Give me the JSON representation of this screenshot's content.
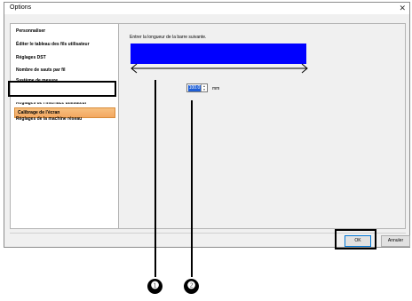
{
  "window": {
    "title": "Options",
    "close_glyph": "✕"
  },
  "sidebar": {
    "items": [
      {
        "label": "Personnaliser"
      },
      {
        "label": "Éditer le tableau des fils utilisateur"
      },
      {
        "label": "Réglages DST"
      },
      {
        "label": "Nombre de sauts par fil"
      },
      {
        "label": "Système de mesure"
      },
      {
        "label": "Calibrage de l'écran",
        "selected": true
      },
      {
        "label": "Réglages de l'interface utilisateur"
      },
      {
        "label": "Réglages de la machine réseau"
      }
    ]
  },
  "content": {
    "instruction": "Entrer la longueur de la barre suivante.",
    "spinner_value": "100.0",
    "unit": "mm",
    "bar_color": "#0000ff"
  },
  "buttons": {
    "ok": "OK",
    "cancel": "Annuler"
  },
  "callouts": [
    "❶",
    "❷"
  ]
}
